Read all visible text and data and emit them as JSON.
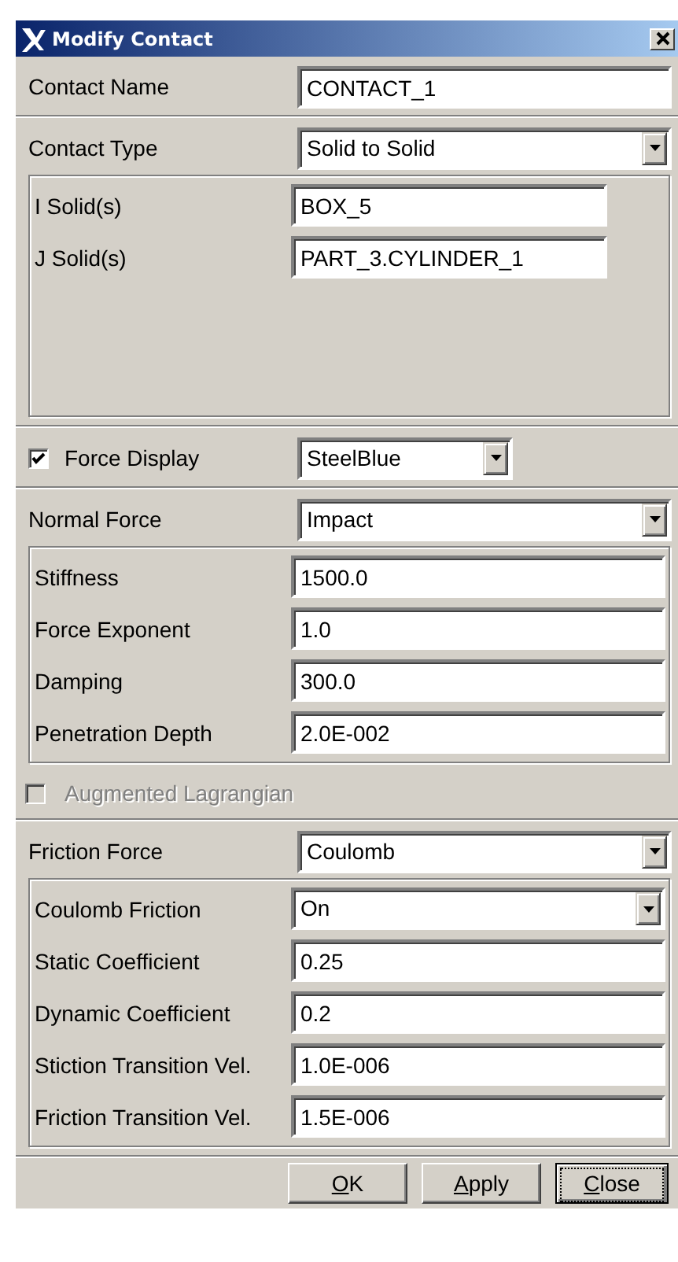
{
  "window": {
    "title": "Modify Contact"
  },
  "panels": [
    [
      {
        "kind": "field",
        "label": "Contact Name",
        "value": "CONTACT_1"
      }
    ],
    [
      {
        "kind": "dropdown",
        "label": "Contact Type",
        "value": "Solid to Solid"
      },
      {
        "kind": "list_group",
        "rows": [
          {
            "kind": "short_field",
            "label": "I Solid(s)",
            "value": "BOX_5"
          },
          {
            "kind": "short_field",
            "label": "J Solid(s)",
            "value": "PART_3.CYLINDER_1"
          }
        ]
      }
    ],
    [
      {
        "kind": "check_dropdown",
        "label": "Force Display",
        "checked": true,
        "value": "SteelBlue"
      }
    ],
    [
      {
        "kind": "dropdown",
        "label": "Normal Force",
        "value": "Impact"
      },
      {
        "kind": "group",
        "rows": [
          {
            "kind": "field",
            "label": "Stiffness",
            "value": "1500.0"
          },
          {
            "kind": "field",
            "label": "Force Exponent",
            "value": "1.0"
          },
          {
            "kind": "field",
            "label": "Damping",
            "value": "300.0"
          },
          {
            "kind": "field",
            "label": "Penetration Depth",
            "value": "2.0E-002"
          }
        ]
      },
      {
        "kind": "checkbox",
        "label": "Augmented Lagrangian",
        "checked": false,
        "disabled": true
      }
    ],
    [
      {
        "kind": "dropdown",
        "label": "Friction Force",
        "value": "Coulomb"
      },
      {
        "kind": "group",
        "rows": [
          {
            "kind": "dropdown",
            "label": "Coulomb Friction",
            "value": "On"
          },
          {
            "kind": "field",
            "label": "Static Coefficient",
            "value": "0.25"
          },
          {
            "kind": "field",
            "label": "Dynamic Coefficient",
            "value": "0.2"
          },
          {
            "kind": "field",
            "label": "Stiction Transition Vel.",
            "value": "1.0E-006"
          },
          {
            "kind": "field",
            "label": "Friction Transition Vel.",
            "value": "1.5E-006"
          }
        ]
      }
    ]
  ],
  "buttons": [
    {
      "label": "OK",
      "underline_first": true,
      "focused": false
    },
    {
      "label": "Apply",
      "underline_first": true,
      "focused": false
    },
    {
      "label": "Close",
      "underline_first": true,
      "focused": true
    }
  ]
}
